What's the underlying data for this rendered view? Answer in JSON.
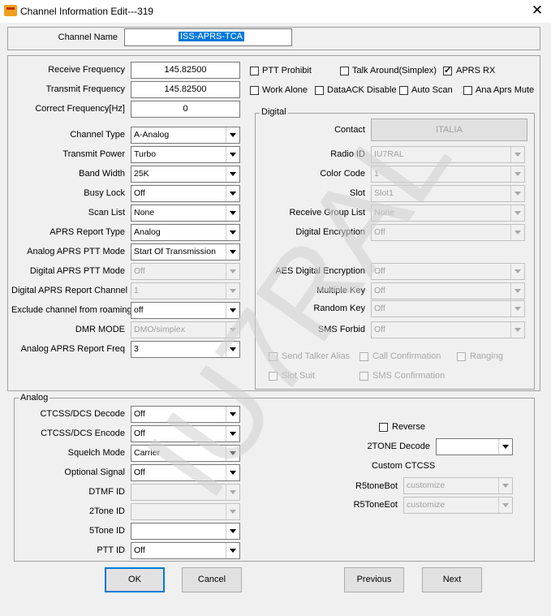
{
  "window": {
    "title": "Channel Information Edit---319",
    "close_glyph": "✕"
  },
  "channel_name": {
    "label": "Channel Name",
    "value": "ISS-APRS-TCA"
  },
  "frequencies": {
    "receive": {
      "label": "Receive Frequency",
      "value": "145.82500"
    },
    "transmit": {
      "label": "Transmit Frequency",
      "value": "145.82500"
    },
    "correct": {
      "label": "Correct Frequency[Hz]",
      "value": "0"
    }
  },
  "checks": {
    "ptt_prohibit": {
      "label": "PTT Prohibit",
      "checked": false
    },
    "talk_around": {
      "label": "Talk Around(Simplex)",
      "checked": false
    },
    "aprs_rx": {
      "label": "APRS RX",
      "checked": true
    },
    "work_alone": {
      "label": "Work Alone",
      "checked": false
    },
    "dataack_disable": {
      "label": "DataACK Disable",
      "checked": false
    },
    "auto_scan": {
      "label": "Auto Scan",
      "checked": false
    },
    "ana_aprs_mute": {
      "label": "Ana Aprs Mute",
      "checked": false
    }
  },
  "settings": {
    "channel_type": {
      "label": "Channel Type",
      "value": "A-Analog"
    },
    "transmit_power": {
      "label": "Transmit Power",
      "value": "Turbo"
    },
    "band_width": {
      "label": "Band Width",
      "value": "25K"
    },
    "busy_lock": {
      "label": "Busy Lock",
      "value": "Off"
    },
    "scan_list": {
      "label": "Scan List",
      "value": "None"
    },
    "aprs_report_type": {
      "label": "APRS Report Type",
      "value": "Analog"
    },
    "analog_aprs_ptt_mode": {
      "label": "Analog APRS PTT Mode",
      "value": "Start Of Transmission"
    },
    "digital_aprs_ptt_mode": {
      "label": "Digital APRS PTT Mode",
      "value": "Off"
    },
    "digital_aprs_report_channel": {
      "label": "Digital APRS Report Channel",
      "value": "1"
    },
    "exclude_roaming": {
      "label": "Exclude channel from roaming",
      "value": "off"
    },
    "dmr_mode": {
      "label": "DMR MODE",
      "value": "DMO/simplex"
    },
    "analog_aprs_report_freq": {
      "label": "Analog APRS Report Freq",
      "value": "3"
    }
  },
  "digital": {
    "legend": "Digital",
    "contact": {
      "label": "Contact",
      "value": "ITALIA"
    },
    "radio_id": {
      "label": "Radio ID",
      "value": "IU7RAL"
    },
    "color_code": {
      "label": "Color Code",
      "value": "1"
    },
    "slot": {
      "label": "Slot",
      "value": "Slot1"
    },
    "receive_group_list": {
      "label": "Receive Group List",
      "value": "None"
    },
    "digital_encryption": {
      "label": "Digital Encryption",
      "value": "Off"
    },
    "aes_digital_encryption": {
      "label": "AES Digital Encryption",
      "value": "Off"
    },
    "multiple_key": {
      "label": "Multiple Key",
      "value": "Off"
    },
    "random_key": {
      "label": "Random Key",
      "value": "Off"
    },
    "sms_forbid": {
      "label": "SMS Forbid",
      "value": "Off"
    },
    "send_talker_alias": {
      "label": "Send Talker Alias"
    },
    "call_confirmation": {
      "label": "Call Confirmation"
    },
    "ranging": {
      "label": "Ranging"
    },
    "slot_suit": {
      "label": "Slot Suit"
    },
    "sms_confirmation": {
      "label": "SMS Confirmation"
    }
  },
  "analog": {
    "legend": "Analog",
    "ctcss_decode": {
      "label": "CTCSS/DCS Decode",
      "value": "Off"
    },
    "ctcss_encode": {
      "label": "CTCSS/DCS Encode",
      "value": "Off"
    },
    "squelch_mode": {
      "label": "Squelch Mode",
      "value": "Carrier"
    },
    "optional_signal": {
      "label": "Optional Signal",
      "value": "Off"
    },
    "dtmf_id": {
      "label": "DTMF ID",
      "value": ""
    },
    "two_tone_id": {
      "label": "2Tone ID",
      "value": ""
    },
    "five_tone_id": {
      "label": "5Tone ID",
      "value": ""
    },
    "ptt_id": {
      "label": "PTT ID",
      "value": "Off"
    },
    "reverse": {
      "label": "Reverse",
      "checked": false
    },
    "two_tone_decode": {
      "label": "2TONE Decode",
      "value": ""
    },
    "custom_ctcss": {
      "label": "Custom CTCSS"
    },
    "r5tone_bot": {
      "label": "R5toneBot",
      "value": "customize"
    },
    "r5tone_eot": {
      "label": "R5ToneEot",
      "value": "customize"
    }
  },
  "buttons": {
    "ok": "OK",
    "cancel": "Cancel",
    "previous": "Previous",
    "next": "Next"
  },
  "watermark": {
    "text": "IU7RAL",
    "color": "#d8d8d8"
  },
  "colors": {
    "selection": "#0078d7",
    "window_bg": "#f0f0f0"
  }
}
